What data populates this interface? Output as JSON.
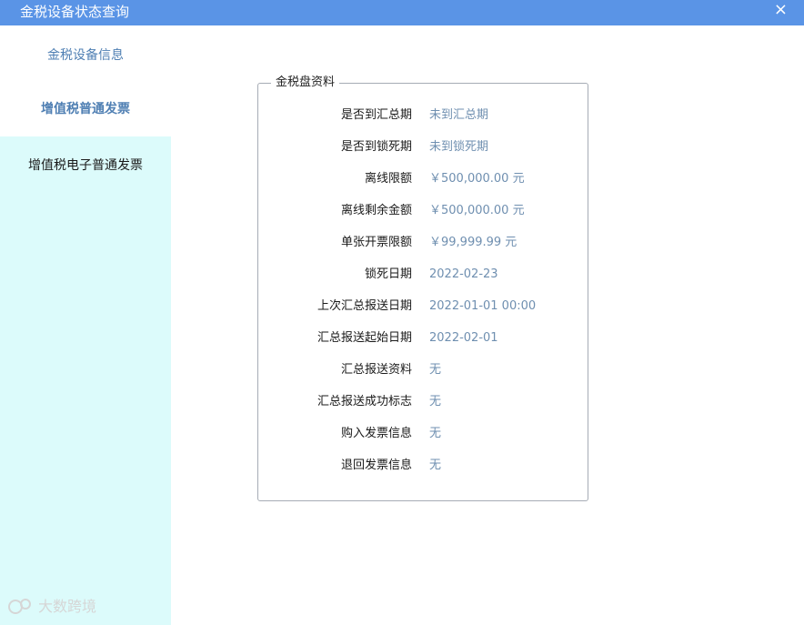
{
  "window": {
    "title": "金税设备状态查询",
    "close_glyph": "×",
    "accent_color": "#5a94e6"
  },
  "sidebar": {
    "items": [
      {
        "label": "金税设备信息"
      },
      {
        "label": "增值税普通发票"
      },
      {
        "label": "增值税电子普通发票"
      }
    ]
  },
  "panel": {
    "legend": "金税盘资料",
    "rows": [
      {
        "label": "是否到汇总期",
        "value": "未到汇总期"
      },
      {
        "label": "是否到锁死期",
        "value": "未到锁死期"
      },
      {
        "label": "离线限额",
        "value": "￥500,000.00 元"
      },
      {
        "label": "离线剩余金额",
        "value": "￥500,000.00 元"
      },
      {
        "label": "单张开票限额",
        "value": "￥99,999.99 元"
      },
      {
        "label": "锁死日期",
        "value": "2022-02-23"
      },
      {
        "label": "上次汇总报送日期",
        "value": "2022-01-01 00:00"
      },
      {
        "label": "汇总报送起始日期",
        "value": "2022-02-01"
      },
      {
        "label": "汇总报送资料",
        "value": "无"
      },
      {
        "label": "汇总报送成功标志",
        "value": "无"
      },
      {
        "label": "购入发票信息",
        "value": "无"
      },
      {
        "label": "退回发票信息",
        "value": "无"
      }
    ]
  },
  "watermark": {
    "text": "大数跨境"
  }
}
